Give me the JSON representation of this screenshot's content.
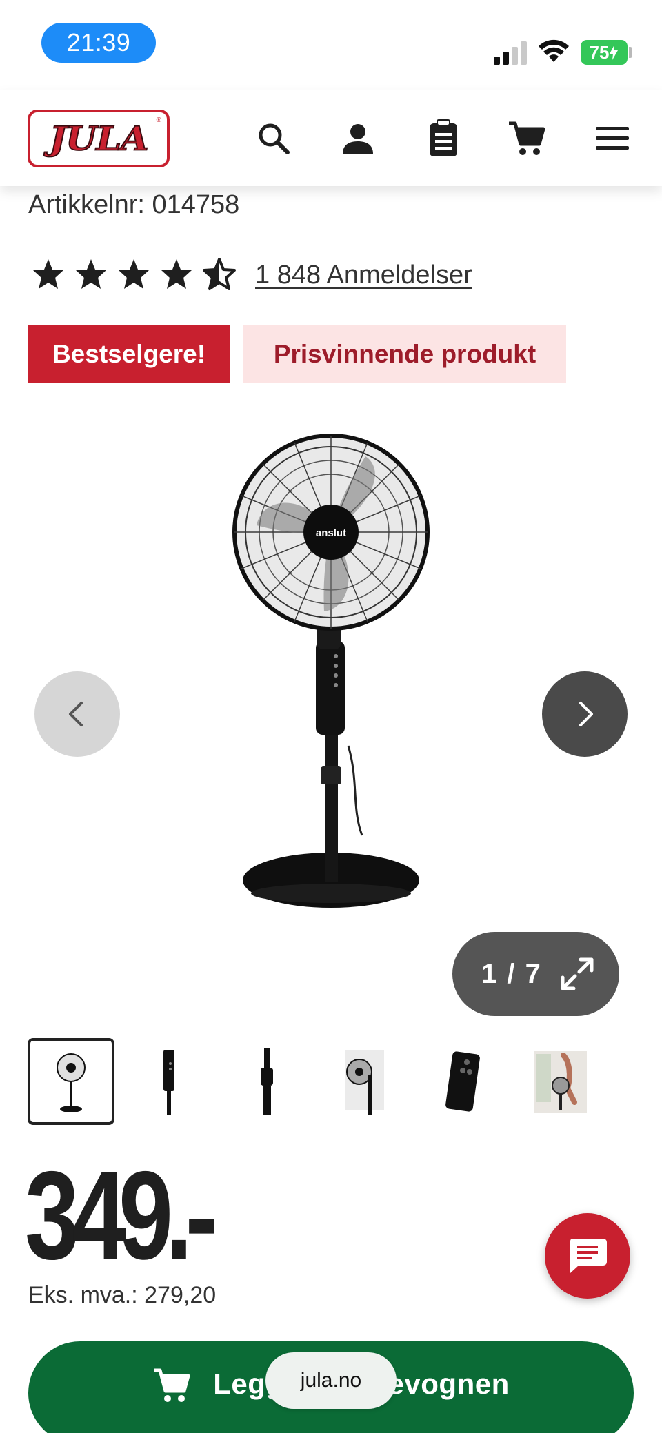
{
  "status_bar": {
    "time": "21:39",
    "battery": "75",
    "icons": [
      "signal-icon",
      "wifi-icon",
      "battery-icon"
    ]
  },
  "header": {
    "logo_text": "JULA",
    "icons": [
      "search-icon",
      "account-icon",
      "list-icon",
      "cart-icon",
      "menu-icon"
    ]
  },
  "product": {
    "article_number": "Artikkelnr: 014758",
    "rating": 4.5,
    "rating_max": 5,
    "reviews_label": "1 848 Anmeldelser",
    "badges": {
      "bestseller": "Bestselgere!",
      "prize": "Prisvinnende produkt"
    },
    "image_brand": "anslut"
  },
  "gallery": {
    "counter": "1 / 7",
    "current": 1,
    "total": 7,
    "thumbnails": [
      "fan-full",
      "fan-stand-panel",
      "fan-height-knob",
      "fan-side-view",
      "remote-control",
      "fan-in-room"
    ]
  },
  "price": {
    "value": "349.-",
    "ex_vat": "Eks. mva.: 279,20"
  },
  "actions": {
    "add_to_cart": "Legg i handlevognen",
    "url": "jula.no"
  },
  "colors": {
    "brand_red": "#c8202f",
    "cart_green": "#0b6b36",
    "badge_pink": "#fce4e4",
    "time_blue": "#1d8cf8",
    "battery_green": "#34c759"
  }
}
